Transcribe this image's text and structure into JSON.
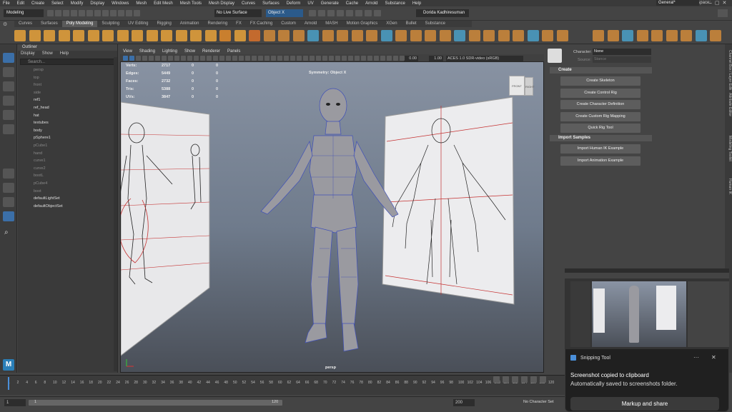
{
  "menubar": {
    "items": [
      "File",
      "Edit",
      "Create",
      "Select",
      "Modify",
      "Display",
      "Windows",
      "Mesh",
      "Edit Mesh",
      "Mesh Tools",
      "Mesh Display",
      "Curves",
      "Surfaces",
      "Deform",
      "UV",
      "Generate",
      "Cache",
      "Arnold",
      "Substance",
      "Help"
    ],
    "workspace_label": "Workspace:",
    "workspace_value": "General*"
  },
  "statusline": {
    "mode": "Modeling",
    "live_surface": "No Live Surface",
    "symmetry": "Object X",
    "user": "Dorida Kadhiresuman"
  },
  "shelf_tabs": [
    "Curves",
    "Surfaces",
    "Poly Modeling",
    "Sculpting",
    "UV Editing",
    "Rigging",
    "Animation",
    "Rendering",
    "FX",
    "FX Caching",
    "Custom",
    "Arnold",
    "MASH",
    "Motion Graphics",
    "XGen",
    "Bullet",
    "Substance"
  ],
  "shelf_active": "Poly Modeling",
  "outliner": {
    "title": "Outliner",
    "menu": [
      "Display",
      "Show",
      "Help"
    ],
    "search_placeholder": "Search...",
    "items": [
      {
        "label": "persp",
        "dim": true
      },
      {
        "label": "top",
        "dim": true
      },
      {
        "label": "front",
        "dim": true
      },
      {
        "label": "side",
        "dim": true
      },
      {
        "label": "ref1",
        "dim": false
      },
      {
        "label": "ref_head",
        "dim": false
      },
      {
        "label": "hat",
        "dim": false
      },
      {
        "label": "textubes",
        "dim": false
      },
      {
        "label": "body",
        "dim": false
      },
      {
        "label": "pSphere1",
        "dim": false
      },
      {
        "label": "pCube1",
        "dim": true
      },
      {
        "label": "hand",
        "dim": true
      },
      {
        "label": "curve1",
        "dim": true
      },
      {
        "label": "curve2",
        "dim": true
      },
      {
        "label": "bootL",
        "dim": true
      },
      {
        "label": "pCube4",
        "dim": true
      },
      {
        "label": "boot",
        "dim": true
      },
      {
        "label": "defaultLightSet",
        "dim": false
      },
      {
        "label": "defaultObjectSet",
        "dim": false
      }
    ]
  },
  "viewport": {
    "menu": [
      "View",
      "Shading",
      "Lighting",
      "Show",
      "Renderer",
      "Panels"
    ],
    "colorspace": "ACES 1.0 SDR-video (sRGB)",
    "exposure": "0.00",
    "gamma": "1.00",
    "symmetry_label": "Symmetry: Object X",
    "camera_label": "persp",
    "hud": [
      {
        "label": "Verts:",
        "a": "2717",
        "b": "0",
        "c": "0"
      },
      {
        "label": "Edges:",
        "a": "5449",
        "b": "0",
        "c": "0"
      },
      {
        "label": "Faces:",
        "a": "2732",
        "b": "0",
        "c": "0"
      },
      {
        "label": "Tris:",
        "a": "5388",
        "b": "0",
        "c": "0"
      },
      {
        "label": "UVs:",
        "a": "3847",
        "b": "0",
        "c": "0"
      }
    ],
    "viewcube_front": "FRONT",
    "viewcube_right": "RIGHT"
  },
  "hik": {
    "character_label": "Character:",
    "character_value": "None",
    "source_label": "Source:",
    "source_value": "Stance",
    "create_header": "Create",
    "create_buttons": [
      "Create Skeleton",
      "Create Control Rig",
      "Create Character Definition",
      "Create Custom Rig Mapping",
      "Quick Rig Tool"
    ],
    "samples_header": "Import Samples",
    "sample_buttons": [
      "Import Human IK Example",
      "Import Animation Example"
    ]
  },
  "side_tabs": [
    "Channel Box / Layer Editor",
    "Attribute Editor",
    "Modeling Toolkit",
    "Human IK"
  ],
  "timeline": {
    "ticks": [
      "1",
      "2",
      "4",
      "6",
      "8",
      "10",
      "12",
      "14",
      "16",
      "18",
      "20",
      "22",
      "24",
      "26",
      "28",
      "30",
      "32",
      "34",
      "36",
      "38",
      "40",
      "42",
      "44",
      "46",
      "48",
      "50",
      "52",
      "54",
      "56",
      "58",
      "60",
      "62",
      "64",
      "66",
      "68",
      "70",
      "72",
      "74",
      "76",
      "78",
      "80",
      "82",
      "84",
      "86",
      "88",
      "90",
      "92",
      "94",
      "96",
      "98",
      "100",
      "102",
      "104",
      "106",
      "108",
      "110",
      "112",
      "114",
      "116",
      "118",
      "120"
    ],
    "current_frame": "1"
  },
  "range": {
    "start": "1",
    "start_inner": "1",
    "end_inner": "120",
    "end": "200",
    "character_set": "No Character Set"
  },
  "snipping": {
    "app": "Snipping Tool",
    "more": "···",
    "close": "✕",
    "message1": "Screenshot copied to clipboard",
    "message2": "Automatically saved to screenshots folder.",
    "button": "Markup and share"
  },
  "colors": {
    "accent": "#4a8fd9",
    "grid_red": "#c53030",
    "wire": "#3f4fb8"
  }
}
